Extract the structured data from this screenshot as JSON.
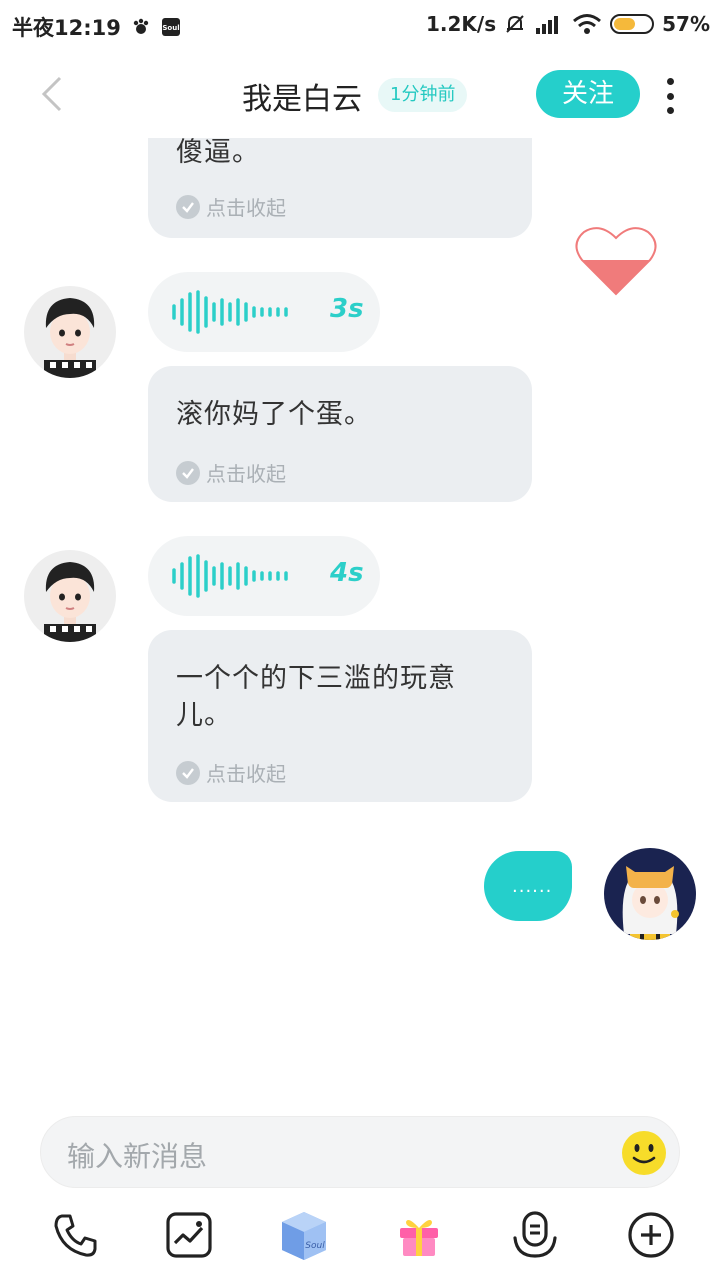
{
  "status_bar": {
    "time": "半夜12:19",
    "net_speed": "1.2K/s",
    "battery": "57%",
    "battery_level": 0.57
  },
  "header": {
    "title": "我是白云",
    "time_badge": "1分钟前",
    "follow_label": "关注"
  },
  "messages": {
    "m1": {
      "text": "傻逼。",
      "collapse": "点击收起"
    },
    "v1": {
      "duration": "3s"
    },
    "m2": {
      "text": "滚你妈了个蛋。",
      "collapse": "点击收起"
    },
    "v2": {
      "duration": "4s"
    },
    "m3": {
      "text": "一个个的下三滥的玩意儿。",
      "collapse": "点击收起"
    },
    "mine": {
      "text": "......"
    }
  },
  "input": {
    "placeholder": "输入新消息"
  },
  "colors": {
    "accent": "#25cfcb",
    "bubble": "#ebeef1",
    "heart": "#f07b7b"
  },
  "toolbar_icons": [
    "phone-icon",
    "image-icon",
    "soul-box-icon",
    "gift-icon",
    "voice-mic-icon",
    "plus-circle-icon"
  ]
}
